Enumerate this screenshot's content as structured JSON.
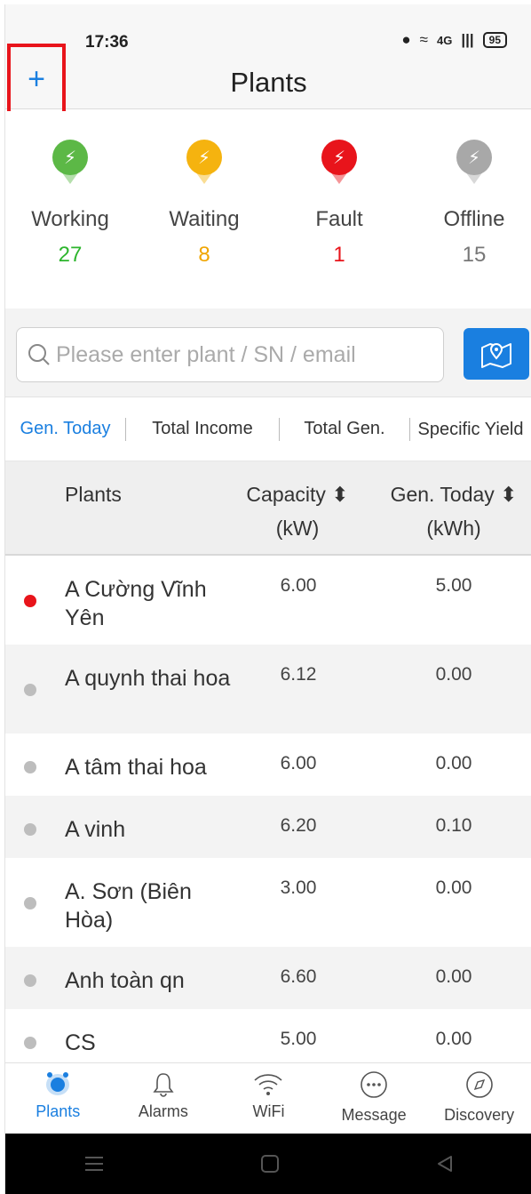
{
  "status_bar": {
    "time": "17:36",
    "signal_1": "4G",
    "battery": "95"
  },
  "header": {
    "add_label": "+",
    "title": "Plants"
  },
  "summary": [
    {
      "label": "Working",
      "count": "27",
      "color": "#5cb846",
      "value_color": "#2db52d"
    },
    {
      "label": "Waiting",
      "count": "8",
      "color": "#f5b30f",
      "value_color": "#f0a500"
    },
    {
      "label": "Fault",
      "count": "1",
      "color": "#e8141b",
      "value_color": "#e8141b"
    },
    {
      "label": "Offline",
      "count": "15",
      "color": "#a8a8a8",
      "value_color": "#777777"
    }
  ],
  "search": {
    "placeholder": "Please enter plant / SN / email"
  },
  "metric_tabs": [
    {
      "label": "Gen. Today",
      "active": true
    },
    {
      "label": "Total Income",
      "active": false
    },
    {
      "label": "Total Gen.",
      "active": false
    },
    {
      "label": "Specific Yield",
      "active": false
    }
  ],
  "table": {
    "col_plants": "Plants",
    "col_capacity": "Capacity ⬍",
    "col_capacity_unit": "(kW)",
    "col_gen": "Gen. Today ⬍",
    "col_gen_unit": "(kWh)",
    "rows": [
      {
        "name": "A Cường Vĩnh Yên",
        "capacity": "6.00",
        "gen_today": "5.00",
        "status_color": "#e8141b"
      },
      {
        "name": "A quynh thai hoa",
        "capacity": "6.12",
        "gen_today": "0.00",
        "status_color": "#bdbdbd"
      },
      {
        "name": "A tâm thai hoa",
        "capacity": "6.00",
        "gen_today": "0.00",
        "status_color": "#bdbdbd"
      },
      {
        "name": "A vinh",
        "capacity": "6.20",
        "gen_today": "0.10",
        "status_color": "#bdbdbd"
      },
      {
        "name": "A. Sơn (Biên Hòa)",
        "capacity": "3.00",
        "gen_today": "0.00",
        "status_color": "#bdbdbd"
      },
      {
        "name": "Anh toàn qn",
        "capacity": "6.60",
        "gen_today": "0.00",
        "status_color": "#bdbdbd"
      },
      {
        "name": "CS",
        "capacity": "5.00",
        "gen_today": "0.00",
        "status_color": "#bdbdbd"
      }
    ]
  },
  "bottom_nav": [
    {
      "label": "Plants",
      "icon": "plants-icon",
      "active": true
    },
    {
      "label": "Alarms",
      "icon": "bell-icon",
      "active": false
    },
    {
      "label": "WiFi",
      "icon": "wifi-icon",
      "active": false
    },
    {
      "label": "Message",
      "icon": "message-icon",
      "active": false
    },
    {
      "label": "Discovery",
      "icon": "compass-icon",
      "active": false
    }
  ],
  "accent_color": "#1a7fe0"
}
